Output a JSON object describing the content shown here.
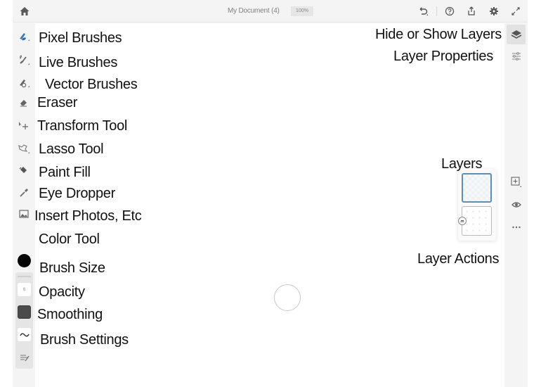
{
  "topbar": {
    "document_title": "My Document (4)",
    "zoom_level": "100%",
    "icons": [
      "home-icon",
      "undo-icon",
      "help-icon",
      "share-icon",
      "gear-icon",
      "fullscreen-icon"
    ]
  },
  "tools": [
    {
      "id": "pixel-brushes",
      "icon": "pixel-brush-icon",
      "label": "Pixel Brushes",
      "active": true
    },
    {
      "id": "live-brushes",
      "icon": "live-brush-icon",
      "label": "Live Brushes"
    },
    {
      "id": "vector-brushes",
      "icon": "vector-brush-icon",
      "label": "Vector Brushes"
    },
    {
      "id": "eraser",
      "icon": "eraser-icon",
      "label": "Eraser"
    },
    {
      "id": "transform-tool",
      "icon": "transform-icon",
      "label": "Transform Tool"
    },
    {
      "id": "lasso-tool",
      "icon": "lasso-icon",
      "label": "Lasso Tool"
    },
    {
      "id": "paint-fill",
      "icon": "paint-bucket-icon",
      "label": "Paint Fill"
    },
    {
      "id": "eye-dropper",
      "icon": "eyedropper-icon",
      "label": "Eye Dropper"
    },
    {
      "id": "insert-photos",
      "icon": "image-icon",
      "label": "Insert Photos, Etc"
    },
    {
      "id": "color-tool",
      "icon": "color-swatch-icon",
      "label": "Color Tool",
      "color": "#050505"
    }
  ],
  "brush_controls": {
    "size_value": "6",
    "size_label": "Brush Size",
    "opacity_label": "Opacity",
    "opacity_color": "#4b4b4b",
    "smoothing_label": "Smoothing",
    "settings_label": "Brush Settings"
  },
  "right_rail": {
    "hide_show_layers_label": "Hide or Show Layers",
    "layer_properties_label": "Layer Properties",
    "layers_label": "Layers",
    "layer_actions_label": "Layer Actions",
    "layer_count": 2,
    "selected_layer_index": 0,
    "accent_color": "#5b8fb8"
  }
}
